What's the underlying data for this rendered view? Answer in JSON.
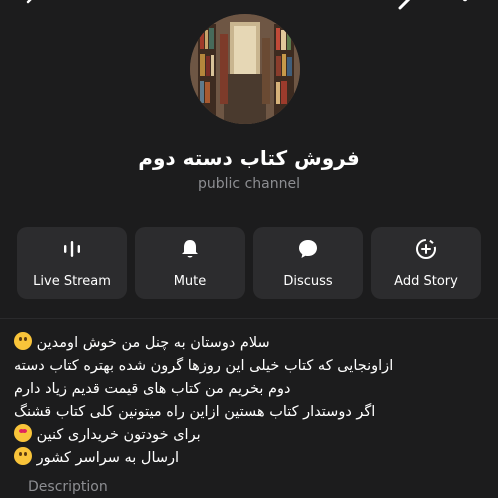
{
  "channel": {
    "title": "فروش کتاب دسته دوم",
    "subtitle": "public channel"
  },
  "actions": [
    {
      "label": "Live Stream",
      "icon": "live-stream-icon"
    },
    {
      "label": "Mute",
      "icon": "bell-icon"
    },
    {
      "label": "Discuss",
      "icon": "chat-bubble-icon"
    },
    {
      "label": "Add Story",
      "icon": "add-story-icon"
    }
  ],
  "description": {
    "lines": [
      "سلام دوستان به چنل من خوش اومدین",
      "ازاونجایی که کتاب خیلی این روزها گرون شده بهتره کتاب دسته",
      "دوم بخریم من کتاب های قیمت قدیم زیاد دارم",
      "اگر دوستدار کتاب هستین ازاین راه میتونین کلی کتاب قشنگ",
      "برای خودتون خریداری کنین",
      "ارسال به سراسر کشور"
    ],
    "label": "Description"
  },
  "colors": {
    "background": "#1c1c1d",
    "button": "#2c2c2e",
    "secondary_text": "#8d8e92"
  }
}
